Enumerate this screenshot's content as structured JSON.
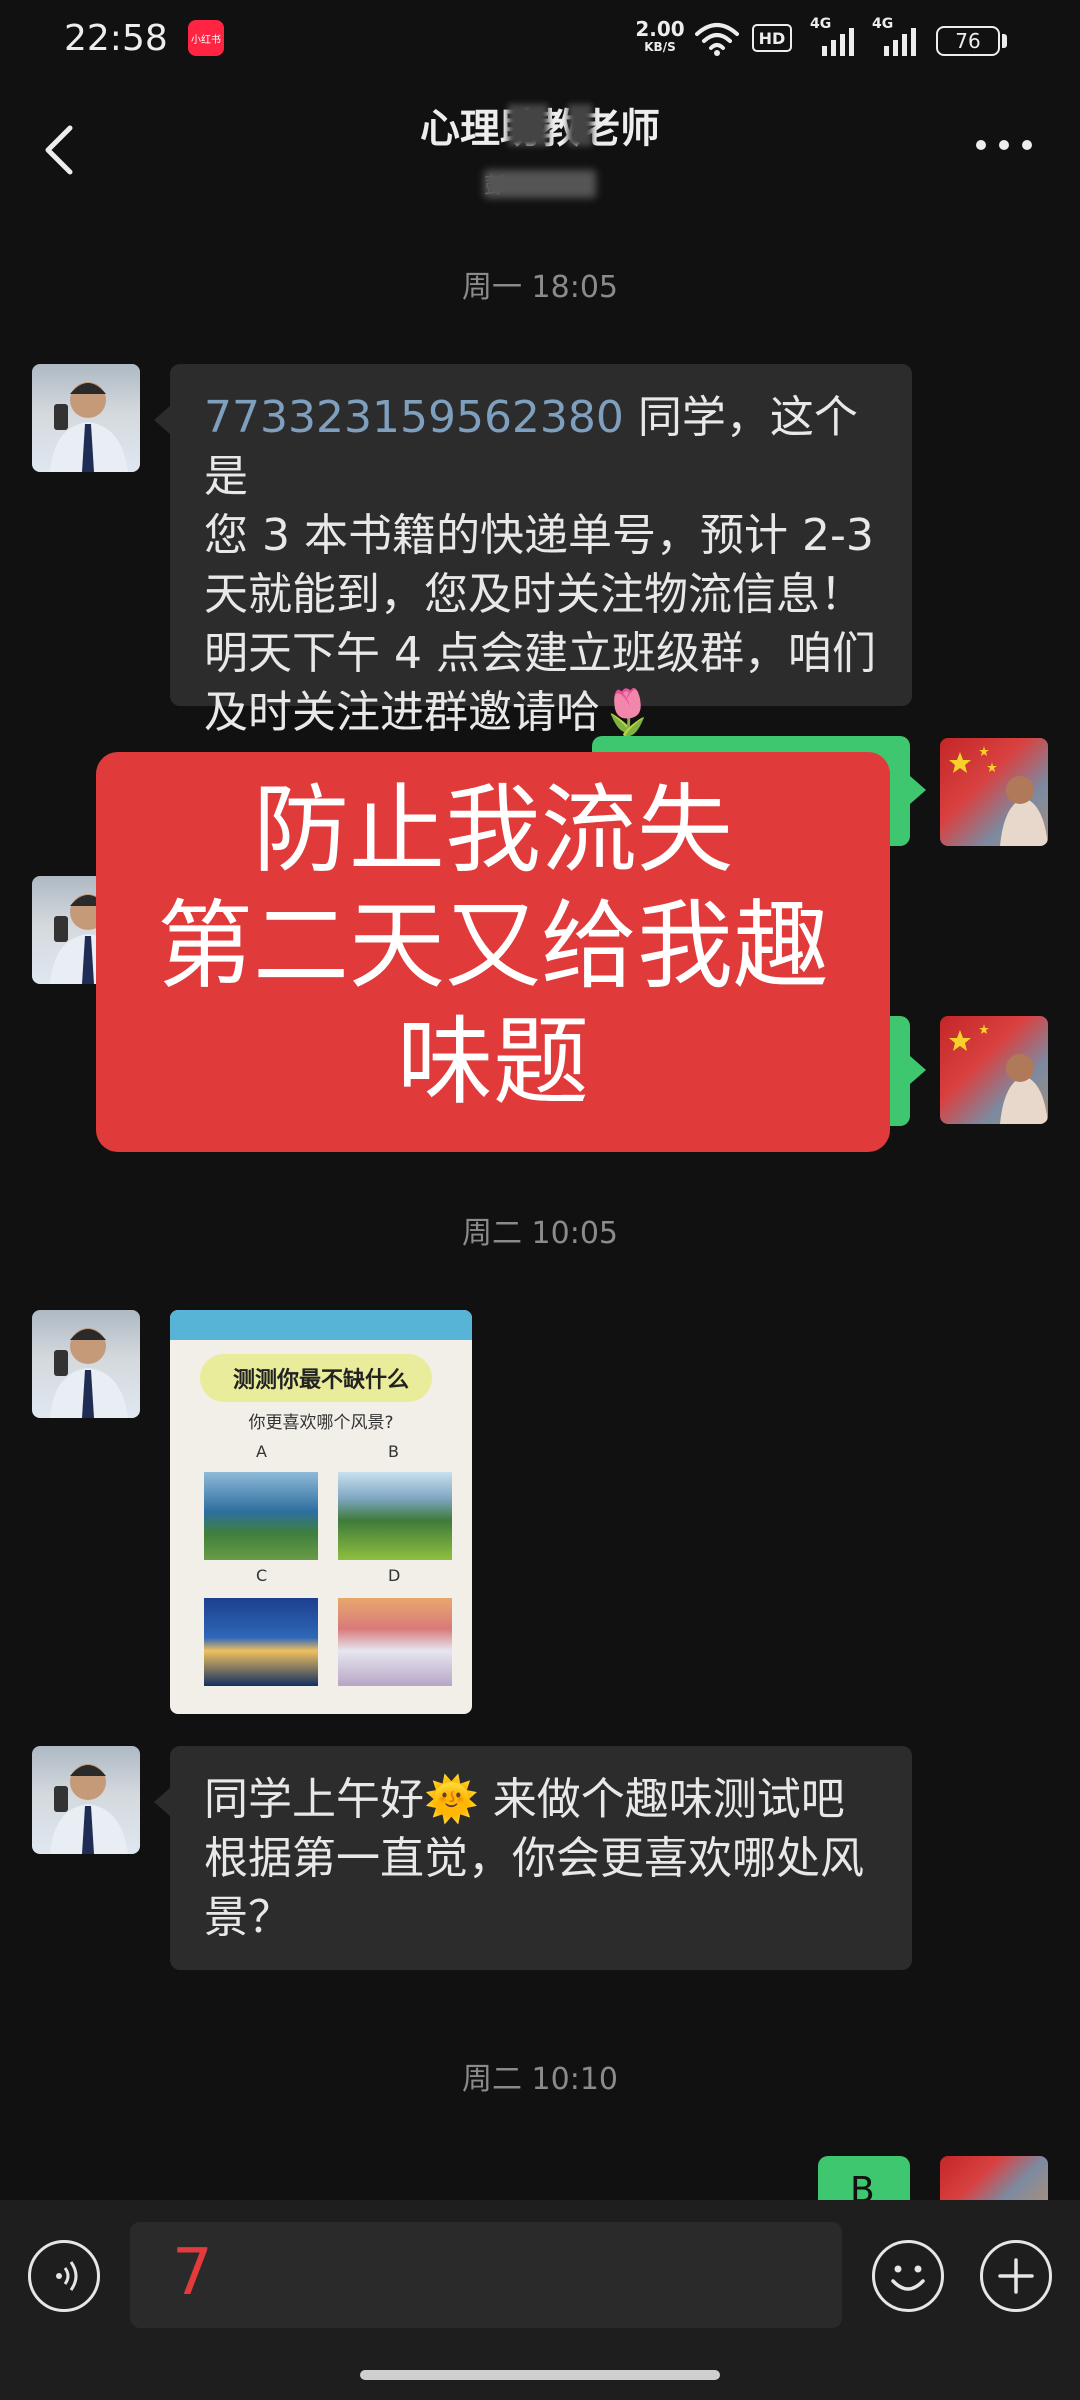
{
  "status_bar": {
    "time": "22:58",
    "app_badge": "小红书",
    "net_speed_value": "2.00",
    "net_speed_unit": "KB/S",
    "hd_label": "HD",
    "signal1_label": "4G",
    "signal2_label": "4G",
    "battery": "76"
  },
  "header": {
    "title": "心理助教老师",
    "subtitle": "彭"
  },
  "timestamps": [
    "周一 18:05",
    "周二 10:05",
    "周二 10:10"
  ],
  "messages": {
    "m1_number": "773323159562380",
    "m1_lines": [
      " 同学，这个是",
      "您 3 本书籍的快递单号，预计 2-3",
      "天就能到，您及时关注物流信息！",
      "明天下午 4 点会建立班级群，咱们",
      "及时关注进群邀请哈🌷"
    ],
    "m4_lines": [
      "同学上午好🌞 来做个趣味测试吧",
      "根据第一直觉，你会更喜欢哪处风",
      "景？"
    ],
    "partial_green_text": "B"
  },
  "overlay": {
    "lines": [
      "防止我流失",
      "第二天又给我趣",
      "味题"
    ]
  },
  "quiz_card": {
    "title": "测测你最不缺什么",
    "question": "你更喜欢哪个风景?",
    "options": [
      "A",
      "B",
      "C",
      "D"
    ]
  },
  "input": {
    "value": "7"
  },
  "colors": {
    "background": "#111111",
    "bubble_in": "#2c2c2c",
    "bubble_out": "#3ec76e",
    "overlay_red": "#e03a3a",
    "link_number": "#7f9fbf"
  },
  "icons": [
    "back-icon",
    "more-icon",
    "voice-icon",
    "emoji-icon",
    "plus-icon",
    "wifi-icon"
  ]
}
